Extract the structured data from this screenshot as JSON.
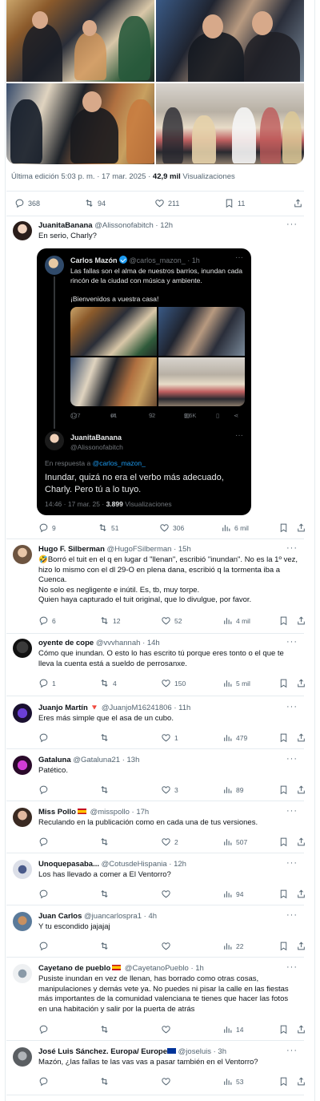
{
  "main": {
    "edited_prefix": "Última edición",
    "edited_time": "5:03 p. m. · 17 mar. 2025",
    "views_count": "42,9 mil",
    "views_label": "Visualizaciones",
    "actions": {
      "replies": "368",
      "retweets": "94",
      "likes": "211",
      "bookmarks": "11"
    }
  },
  "embed": {
    "author_name": "Carlos Mazón",
    "author_handle": "@carlos_mazon_",
    "author_time": "· 1h",
    "text": "Las fallas son el alma de nuestros barrios, inundan cada rincón de la ciudad con música y ambiente.",
    "text2": "¡Bienvenidos a vuestra casa!",
    "actions": {
      "replies": "127",
      "retweets": "61",
      "likes": "92",
      "views": "9,6K"
    },
    "reply": {
      "name": "JuanitaBanana",
      "handle": "@Alissonofabitch",
      "reply_prefix": "En respuesta a",
      "reply_mention": "@carlos_mazon_",
      "text": "Inundar, quizá no era el verbo más adecuado, Charly. Pero tú a lo tuyo.",
      "time": "14:46 · 17 mar. 25 ·",
      "views_count": "3.899",
      "views_label": "Visualizaciones"
    }
  },
  "replies": [
    {
      "name": "JuanitaBanana",
      "handle": "@Alissonofabitch",
      "time": "· 12h",
      "lines": [
        "En serio, Charly?"
      ],
      "replies": "9",
      "retweets": "51",
      "likes": "306",
      "views": "6 mil"
    },
    {
      "name": "Hugo F. Silberman",
      "handle": "@HugoFSilberman",
      "time": "· 15h",
      "lines": [
        "🤣Borró el tuit en el q en lugar d \"llenan\", escribió \"inundan\". No es la 1º vez,",
        "hizo lo mismo con el dl 29-O en plena dana, escribió q la tormenta iba a",
        "Cuenca.",
        "No solo es negligente e inútil. Es, tb, muy torpe.",
        "Quien haya capturado el tuit original, que lo divulgue, por favor."
      ],
      "replies": "6",
      "retweets": "12",
      "likes": "52",
      "views": "4 mil"
    },
    {
      "name": "oyente de cope",
      "handle": "@vvvhannah",
      "time": "· 14h",
      "lines": [
        "Cómo que inundan. O esto lo has escrito tú porque eres tonto o el que te",
        "lleva la cuenta está a sueldo de perrosanxe."
      ],
      "replies": "1",
      "retweets": "4",
      "likes": "150",
      "views": "5 mil"
    },
    {
      "name": "Juanjo Martín",
      "handle": "@JuanjoM16241806",
      "time": "· 11h",
      "lines": [
        "Eres más simple que el asa de un cubo."
      ],
      "replies": "",
      "retweets": "",
      "likes": "1",
      "views": "479"
    },
    {
      "name": "Gataluna",
      "handle": "@Gataluna21",
      "time": "· 13h",
      "lines": [
        "Patético."
      ],
      "replies": "",
      "retweets": "",
      "likes": "3",
      "views": "89"
    },
    {
      "name": "Miss Pollo",
      "handle": "@misspollo",
      "time": "· 17h",
      "lines": [
        "Reculando en la publicación como en cada una de tus versiones."
      ],
      "replies": "",
      "retweets": "",
      "likes": "2",
      "views": "507"
    },
    {
      "name": "Unoquepasaba...",
      "handle": "@CotusdeHispania",
      "time": "· 12h",
      "lines": [
        "Los has llevado a comer a El Ventorro?"
      ],
      "replies": "",
      "retweets": "",
      "likes": "",
      "views": "94"
    },
    {
      "name": "Juan Carlos",
      "handle": "@juancarlospra1",
      "time": "· 4h",
      "lines": [
        "Y tu escondido jajajaj"
      ],
      "replies": "",
      "retweets": "",
      "likes": "",
      "views": "22"
    },
    {
      "name": "Cayetano de pueblo",
      "handle": "@CayetanoPueblo",
      "time": "· 1h",
      "lines": [
        "Pusiste inundan en vez de llenan, has borrado como otras cosas,",
        "manipulaciones y demás vete ya. No puedes ni pisar la calle en las fiestas",
        "más importantes de la comunidad valenciana te tienes que hacer las fotos",
        "en una habitación y salir por la puerta de atrás"
      ],
      "replies": "",
      "retweets": "",
      "likes": "",
      "views": "14"
    },
    {
      "name": "José Luis Sánchez. Europa/ Europe",
      "handle": "@joseluis",
      "time": "· 3h",
      "lines": [
        "Mazón, ¿las fallas te las vas vas a pasar también en el Ventorro?"
      ],
      "replies": "",
      "retweets": "",
      "likes": "",
      "views": "53"
    }
  ]
}
